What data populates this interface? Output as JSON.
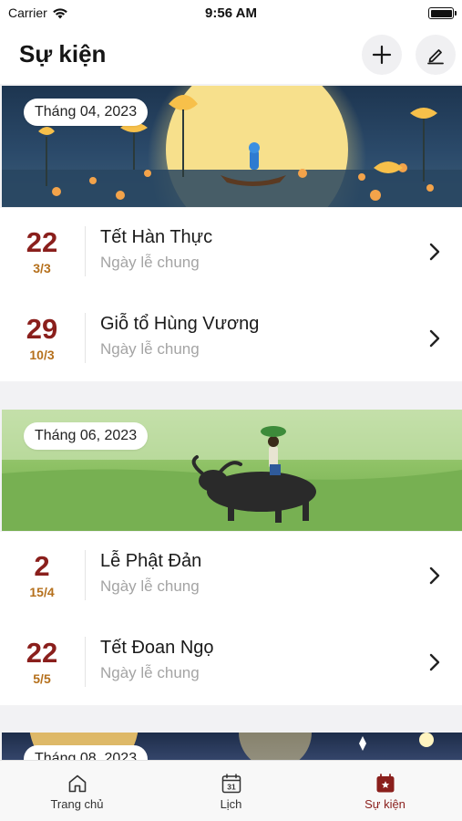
{
  "status_bar": {
    "carrier": "Carrier",
    "time": "9:56 AM"
  },
  "header": {
    "title": "Sự kiện"
  },
  "sections": [
    {
      "month_label": "Tháng 04, 2023",
      "events": [
        {
          "solar_day": "22",
          "lunar_date": "3/3",
          "name": "Tết Hàn Thực",
          "type": "Ngày lễ chung"
        },
        {
          "solar_day": "29",
          "lunar_date": "10/3",
          "name": "Giỗ tổ Hùng Vương",
          "type": "Ngày lễ chung"
        }
      ]
    },
    {
      "month_label": "Tháng 06, 2023",
      "events": [
        {
          "solar_day": "2",
          "lunar_date": "15/4",
          "name": "Lễ Phật Đản",
          "type": "Ngày lễ chung"
        },
        {
          "solar_day": "22",
          "lunar_date": "5/5",
          "name": "Tết Đoan Ngọ",
          "type": "Ngày lễ chung"
        }
      ]
    },
    {
      "month_label": "Tháng 08, 2023"
    }
  ],
  "tab_bar": {
    "items": [
      {
        "label": "Trang chủ",
        "icon": "home-icon"
      },
      {
        "label": "Lịch",
        "icon": "calendar-icon",
        "calendar_number": "31"
      },
      {
        "label": "Sự kiện",
        "icon": "event-calendar-icon"
      }
    ],
    "active_index": 2
  },
  "colors": {
    "accent": "#8a1f1c",
    "lunar": "#b5701c",
    "muted": "#a4a4a4"
  }
}
